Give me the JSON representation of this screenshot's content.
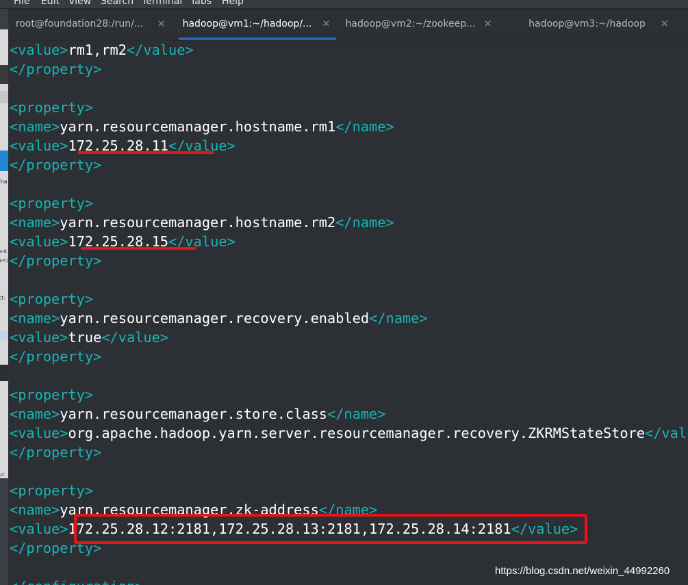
{
  "menu": [
    "File",
    "Edit",
    "View",
    "Search",
    "Terminal",
    "Tabs",
    "Help"
  ],
  "tabs": [
    {
      "label": "root@foundation28:/run/...",
      "active": false
    },
    {
      "label": "hadoop@vm1:~/hadoop/...",
      "active": true
    },
    {
      "label": "hadoop@vm2:~/zookeep...",
      "active": false
    },
    {
      "label": "hadoop@vm3:~/hadoop",
      "active": false
    }
  ],
  "tab_close_glyph": "×",
  "left_strip_fragments": [
    "/na",
    "e-k",
    "a</",
    "ct-",
    "ur"
  ],
  "lines": [
    {
      "open": "<value>",
      "text": "rm1,rm2",
      "close": "</value>"
    },
    {
      "open": "</property>",
      "text": "",
      "close": ""
    },
    {
      "open": "",
      "text": "",
      "close": ""
    },
    {
      "open": "<property>",
      "text": "",
      "close": ""
    },
    {
      "open": "<name>",
      "text": "yarn.resourcemanager.hostname.rm1",
      "close": "</name>"
    },
    {
      "open": "<value>",
      "text": "172.25.28.11",
      "close": "</value>"
    },
    {
      "open": "</property>",
      "text": "",
      "close": ""
    },
    {
      "open": "",
      "text": "",
      "close": ""
    },
    {
      "open": "<property>",
      "text": "",
      "close": ""
    },
    {
      "open": "<name>",
      "text": "yarn.resourcemanager.hostname.rm2",
      "close": "</name>"
    },
    {
      "open": "<value>",
      "text": "172.25.28.15",
      "close": "</value>"
    },
    {
      "open": "</property>",
      "text": "",
      "close": ""
    },
    {
      "open": "",
      "text": "",
      "close": ""
    },
    {
      "open": "<property>",
      "text": "",
      "close": ""
    },
    {
      "open": "<name>",
      "text": "yarn.resourcemanager.recovery.enabled",
      "close": "</name>"
    },
    {
      "open": "<value>",
      "text": "true",
      "close": "</value>"
    },
    {
      "open": "</property>",
      "text": "",
      "close": ""
    },
    {
      "open": "",
      "text": "",
      "close": ""
    },
    {
      "open": "<property>",
      "text": "",
      "close": ""
    },
    {
      "open": "<name>",
      "text": "yarn.resourcemanager.store.class",
      "close": "</name>"
    },
    {
      "open": "<value>",
      "text": "org.apache.hadoop.yarn.server.resourcemanager.recovery.ZKRMStateStore",
      "close": "</value>"
    },
    {
      "open": "</property>",
      "text": "",
      "close": ""
    },
    {
      "open": "",
      "text": "",
      "close": ""
    },
    {
      "open": "<property>",
      "text": "",
      "close": ""
    },
    {
      "open": "<name>",
      "text": "yarn.resourcemanager.zk-address",
      "close": "</name>"
    },
    {
      "open": "<value>",
      "text": "172.25.28.12:2181,172.25.28.13:2181,172.25.28.14:2181",
      "close": "</value>"
    },
    {
      "open": "</property>",
      "text": "",
      "close": ""
    },
    {
      "open": "",
      "text": "",
      "close": ""
    },
    {
      "open": "</configuration>",
      "text": "",
      "close": ""
    }
  ],
  "watermark": "https://blog.csdn.net/weixin_44992260",
  "colors": {
    "tag": "#1bb3b3",
    "text": "#ffffff",
    "annotation": "#e8141a",
    "background": "#2c3035",
    "active_tab": "#2a76c6"
  }
}
